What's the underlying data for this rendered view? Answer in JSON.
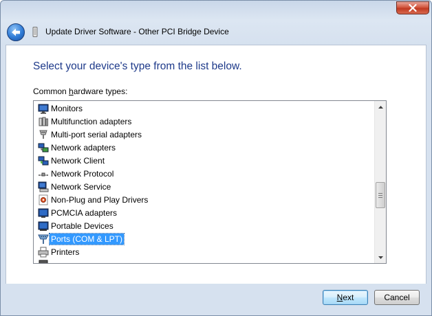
{
  "window": {
    "title": "Update Driver Software - Other PCI Bridge Device",
    "close_glyph": "✕"
  },
  "main": {
    "heading": "Select your device's type from the list below.",
    "list_label_pre": "Common ",
    "list_label_accel": "h",
    "list_label_post": "ardware types:"
  },
  "list": {
    "items": [
      {
        "label": "Monitors",
        "icon": "monitor-icon"
      },
      {
        "label": "Multifunction adapters",
        "icon": "multifunction-adapter-icon"
      },
      {
        "label": "Multi-port serial adapters",
        "icon": "serial-adapter-icon"
      },
      {
        "label": "Network adapters",
        "icon": "network-adapter-icon"
      },
      {
        "label": "Network Client",
        "icon": "network-client-icon"
      },
      {
        "label": "Network Protocol",
        "icon": "network-protocol-icon"
      },
      {
        "label": "Network Service",
        "icon": "network-service-icon"
      },
      {
        "label": "Non-Plug and Play Drivers",
        "icon": "non-pnp-driver-icon"
      },
      {
        "label": "PCMCIA adapters",
        "icon": "pcmcia-icon"
      },
      {
        "label": "Portable Devices",
        "icon": "portable-device-icon"
      },
      {
        "label": "Ports (COM & LPT)",
        "icon": "port-icon"
      },
      {
        "label": "Printers",
        "icon": "printer-icon"
      }
    ],
    "selected_index": 10
  },
  "footer": {
    "next_accel": "N",
    "next_rest": "ext",
    "cancel_label": "Cancel"
  },
  "colors": {
    "heading": "#1e3a8a",
    "selection": "#3399ff"
  }
}
